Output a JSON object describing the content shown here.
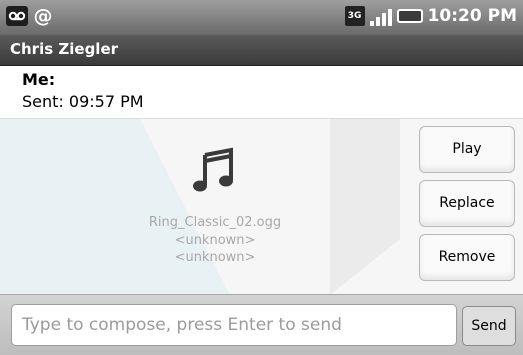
{
  "status_bar": {
    "left_icons": [
      "voicemail-icon",
      "at-icon"
    ],
    "network_icon": "3g-icon",
    "network_label": "3G",
    "signal_icon": "signal-icon",
    "battery_icon": "battery-icon",
    "time": "10:20 PM"
  },
  "title_bar": {
    "title": "Chris Ziegler"
  },
  "message": {
    "sender_label": "Me:",
    "sent_text": "Sent: 09:57 PM"
  },
  "attachment": {
    "icon": "music-note-icon",
    "file_name": "Ring_Classic_02.ogg",
    "artist": "<unknown>",
    "album": "<unknown>"
  },
  "actions": {
    "play": "Play",
    "replace": "Replace",
    "remove": "Remove"
  },
  "compose": {
    "placeholder": "Type to compose, press Enter to send",
    "send_label": "Send"
  }
}
